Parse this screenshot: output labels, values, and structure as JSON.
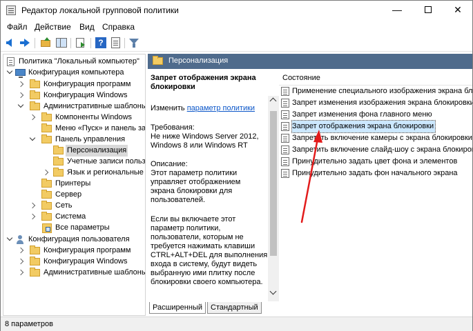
{
  "window": {
    "title": "Редактор локальной групповой политики",
    "minimize_glyph": "—",
    "close_glyph": "✕"
  },
  "menu": [
    "Файл",
    "Действие",
    "Вид",
    "Справка"
  ],
  "toolbar": {
    "help_glyph": "?",
    "icons": [
      "back-icon",
      "forward-icon",
      "folder-up-icon",
      "show-hide-tree-icon",
      "export-list-icon",
      "help-icon",
      "sheet-icon",
      "filter-icon"
    ]
  },
  "tree": {
    "root": "Политика \"Локальный компьютер\"",
    "computer_config": "Конфигурация компьютера",
    "cc_programs": "Конфигурация программ",
    "cc_windows": "Конфигурация Windows",
    "cc_admin_templates": "Административные шаблоны",
    "windows_components": "Компоненты Windows",
    "start_menu": "Меню «Пуск» и панель задач",
    "control_panel": "Панель управления",
    "personalization": "Персонализация",
    "user_accounts": "Учетные записи пользователей",
    "language": "Язык и региональные стандарты",
    "printers": "Принтеры",
    "server": "Сервер",
    "network": "Сеть",
    "system": "Система",
    "all_settings": "Все параметры",
    "user_config": "Конфигурация пользователя",
    "uc_programs": "Конфигурация программ",
    "uc_windows": "Конфигурация Windows",
    "uc_admin_templates": "Административные шаблоны"
  },
  "content": {
    "header": "Персонализация",
    "description": {
      "title_line1": "Запрет отображения экрана",
      "title_line2": "блокировки",
      "edit_prefix": "Изменить",
      "edit_link": "параметр политики",
      "requirements_label": "Требования:",
      "requirements_line1": "Не ниже Windows Server 2012,",
      "requirements_line2": "Windows 8 или Windows RT",
      "description_label": "Описание:",
      "desc_lines": [
        "Этот параметр политики",
        "управляет отображением",
        "экрана блокировки для",
        "пользователей."
      ],
      "more_lines": [
        "Если вы включаете этот",
        "параметр политики,",
        "пользователи, которым не",
        "требуется нажимать клавиши",
        "CTRL+ALT+DEL для выполнения",
        "входа в систему, будут видеть",
        "выбранную ими плитку после",
        "блокировки своего компьютера."
      ]
    },
    "list_column": "Состояние",
    "policies": [
      "Применение специального изображения экрана блокировки",
      "Запрет изменения изображения экрана блокировки",
      "Запрет изменения фона главного меню",
      "Запрет отображения экрана блокировки",
      "Запретить включение камеры с экрана блокировки",
      "Запретить включение слайд-шоу с экрана блокировки",
      "Принудительно задать цвет фона и элементов",
      "Принудительно задать фон начального экрана"
    ],
    "selected_policy_index": 3,
    "tabs": {
      "extended": "Расширенный",
      "standard": "Стандартный"
    }
  },
  "status": "8 параметров",
  "colors": {
    "header_bg": "#4f6b8c",
    "selection": "#cce8ff",
    "link": "#0a55c8",
    "annotation_arrow": "#e21b1b"
  }
}
